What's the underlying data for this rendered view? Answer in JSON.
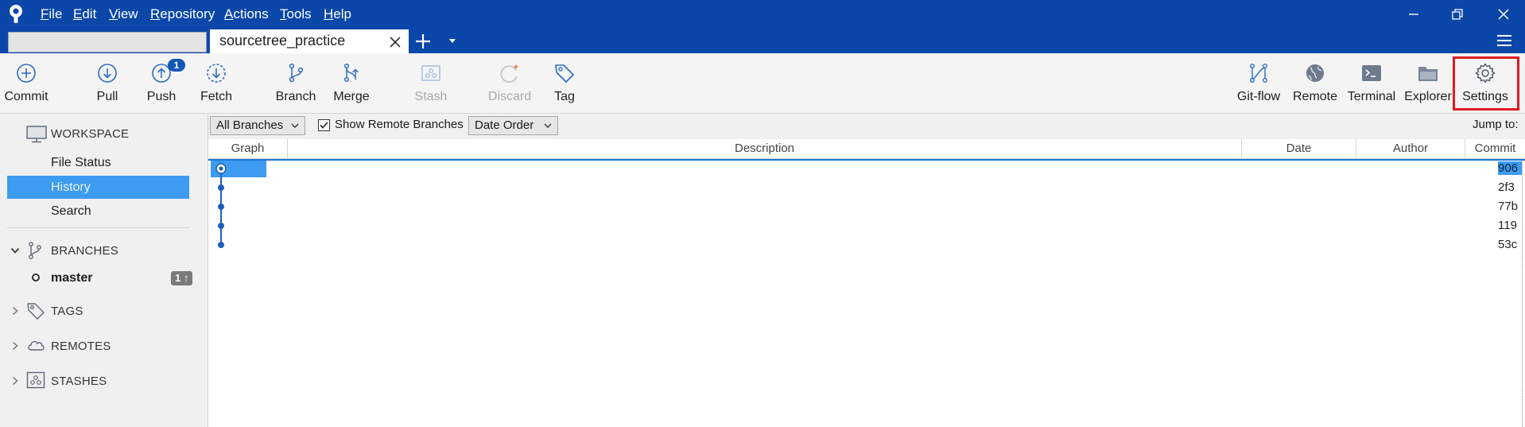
{
  "menu": {
    "items": [
      {
        "label": "File",
        "accel": "F",
        "rest": "ile"
      },
      {
        "label": "Edit",
        "accel": "E",
        "rest": "dit"
      },
      {
        "label": "View",
        "accel": "V",
        "rest": "iew"
      },
      {
        "label": "Repository",
        "accel": "R",
        "rest": "epository"
      },
      {
        "label": "Actions",
        "accel": "A",
        "rest": "ctions"
      },
      {
        "label": "Tools",
        "accel": "T",
        "rest": "ools"
      },
      {
        "label": "Help",
        "accel": "H",
        "rest": "elp"
      }
    ]
  },
  "tabs": {
    "active_label": "sourcetree_practice"
  },
  "toolbar": {
    "commit": "Commit",
    "pull": "Pull",
    "push": "Push",
    "push_badge": "1",
    "fetch": "Fetch",
    "branch": "Branch",
    "merge": "Merge",
    "stash": "Stash",
    "discard": "Discard",
    "tag": "Tag",
    "gitflow": "Git-flow",
    "remote": "Remote",
    "terminal": "Terminal",
    "explorer": "Explorer",
    "settings": "Settings"
  },
  "sidebar": {
    "workspace": "WORKSPACE",
    "file_status": "File Status",
    "history": "History",
    "search": "Search",
    "branches": "BRANCHES",
    "master": "master",
    "master_badge": "1 ↑",
    "tags": "TAGS",
    "remotes": "REMOTES",
    "stashes": "STASHES"
  },
  "filters": {
    "branches_combo": "All Branches",
    "show_remote": "Show Remote Branches",
    "order_combo": "Date Order",
    "jump_to": "Jump to:"
  },
  "table": {
    "columns": {
      "graph": "Graph",
      "description": "Description",
      "date": "Date",
      "author": "Author",
      "commit": "Commit"
    },
    "commits": [
      "906",
      "2f3",
      "77b",
      "119",
      "53c"
    ]
  },
  "colors": {
    "titlebar": "#0b47a8",
    "selection": "#3d9bf1",
    "highlight": "#e01b22",
    "graph_line": "#1e5fb8"
  }
}
